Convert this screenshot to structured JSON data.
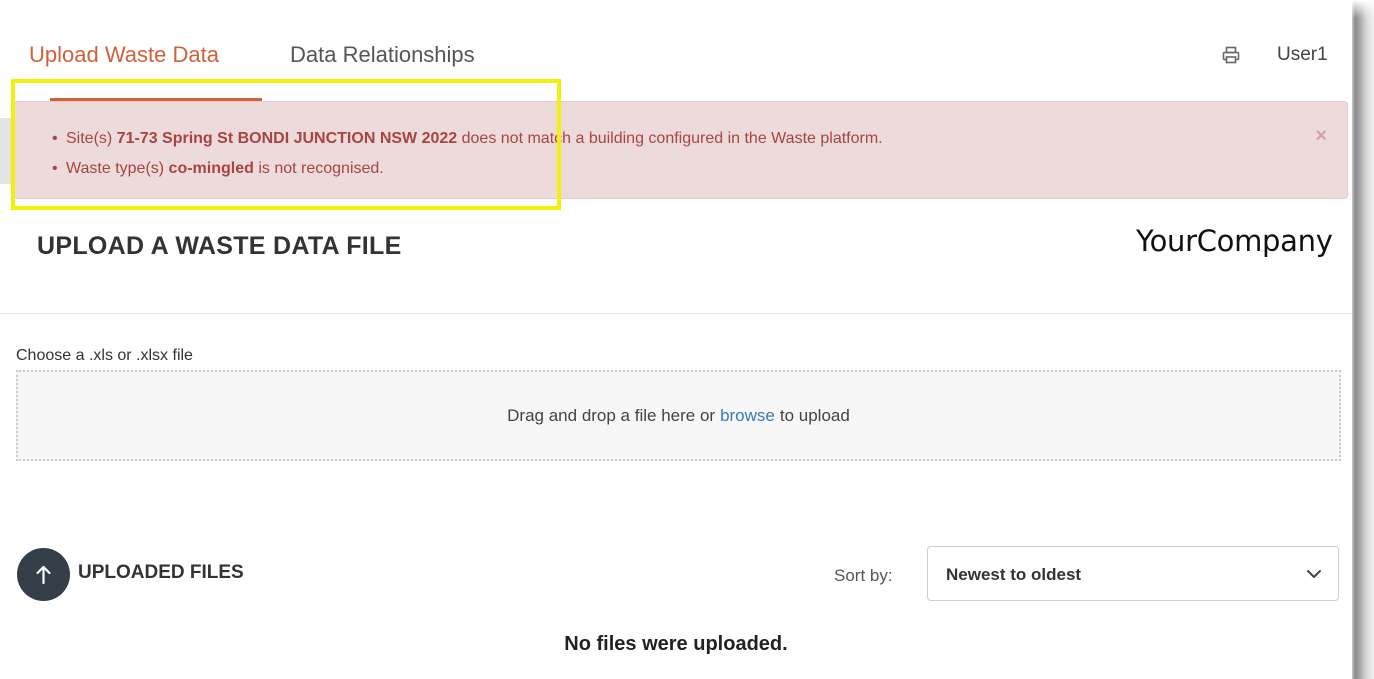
{
  "nav": {
    "tabs": [
      {
        "label": "Upload Waste Data",
        "active": true
      },
      {
        "label": "Data Relationships",
        "active": false
      }
    ],
    "print_icon": "printer-icon",
    "user_label": "User1",
    "accent_color": "#d0623b"
  },
  "alert": {
    "items": [
      {
        "before": "Site(s) ",
        "bold": "71-73 Spring St BONDI JUNCTION NSW 2022",
        "after": " does not match a building configured in the Waste platform."
      },
      {
        "before": "Waste type(s) ",
        "bold": "co-mingled",
        "after": " is not recognised."
      }
    ],
    "close_label": "×",
    "text_color": "#a94442",
    "background": "#eddbdb"
  },
  "section_title": "UPLOAD A WASTE DATA FILE",
  "company_logo": "YourCompany",
  "upload": {
    "label": "Choose a .xls or .xlsx file",
    "drop_text_before": "Drag and drop a file here or",
    "browse_label": "browse",
    "drop_text_after": "to upload"
  },
  "uploaded": {
    "button_icon": "arrow-up-icon",
    "title": "UPLOADED FILES",
    "sort_label": "Sort by:",
    "sort_value": "Newest to oldest",
    "empty_message": "No files were uploaded."
  }
}
